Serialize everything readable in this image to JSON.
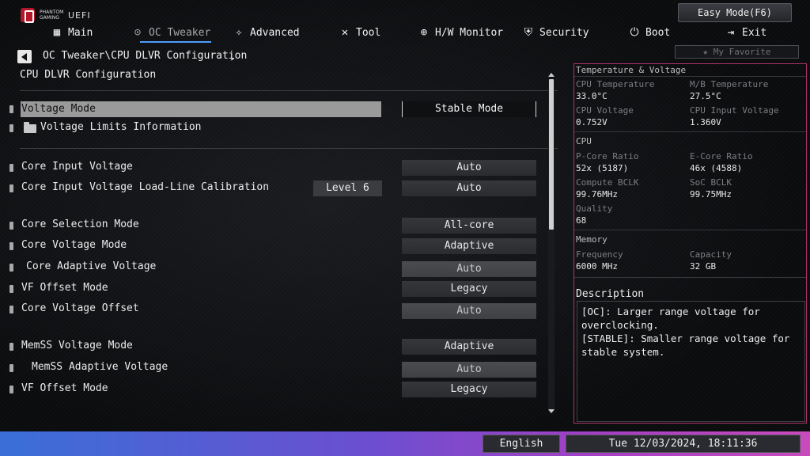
{
  "header": {
    "brand_small": "PHANTOM GAMING",
    "brand_uefi": "UEFI",
    "easy_mode_label": "Easy Mode(F6)",
    "favorite_label": "★ My Favorite"
  },
  "nav": [
    {
      "label": "Main",
      "icon": "grid-icon",
      "glyph": "▦"
    },
    {
      "label": "OC Tweaker",
      "icon": "circuit-icon",
      "glyph": "⊙"
    },
    {
      "label": "Advanced",
      "icon": "star-icon",
      "glyph": "✧"
    },
    {
      "label": "Tool",
      "icon": "tools-icon",
      "glyph": "✕"
    },
    {
      "label": "H/W Monitor",
      "icon": "monitor-icon",
      "glyph": "⊕"
    },
    {
      "label": "Security",
      "icon": "shield-icon",
      "glyph": "⛨"
    },
    {
      "label": "Boot",
      "icon": "power-icon",
      "glyph": "⏻"
    },
    {
      "label": "Exit",
      "icon": "exit-icon",
      "glyph": "⇥"
    }
  ],
  "breadcrumb": "OC Tweaker\\CPU DLVR Configuration",
  "page_title": "CPU DLVR Configuration",
  "settings": {
    "voltage_mode": {
      "label": "Voltage Mode",
      "value": "Stable Mode"
    },
    "voltage_limits": {
      "label": "Voltage Limits Information"
    },
    "core_input_voltage": {
      "label": "Core Input Voltage",
      "value": "Auto"
    },
    "core_input_llc": {
      "label": "Core Input Voltage Load-Line Calibration",
      "level": "Level 6",
      "value": "Auto"
    },
    "core_selection_mode": {
      "label": "Core Selection Mode",
      "value": "All-core"
    },
    "core_voltage_mode": {
      "label": "Core Voltage Mode",
      "value": "Adaptive"
    },
    "core_adaptive_voltage": {
      "label": "Core Adaptive Voltage",
      "value": "Auto"
    },
    "vf_offset_mode_1": {
      "label": "VF Offset Mode",
      "value": "Legacy"
    },
    "core_voltage_offset": {
      "label": "Core Voltage Offset",
      "value": "Auto"
    },
    "memss_voltage_mode": {
      "label": "MemSS Voltage Mode",
      "value": "Adaptive"
    },
    "memss_adaptive_voltage": {
      "label": "MemSS Adaptive Voltage",
      "value": "Auto"
    },
    "vf_offset_mode_2": {
      "label": "VF Offset Mode",
      "value": "Legacy"
    }
  },
  "info": {
    "temp_voltage_head": "Temperature & Voltage",
    "cpu_temp_label": "CPU Temperature",
    "cpu_temp": "33.0°C",
    "mb_temp_label": "M/B Temperature",
    "mb_temp": "27.5°C",
    "cpu_voltage_label": "CPU Voltage",
    "cpu_voltage": "0.752V",
    "cpu_input_voltage_label": "CPU Input Voltage",
    "cpu_input_voltage": "1.360V",
    "cpu_head": "CPU",
    "pcore_label": "P-Core Ratio",
    "pcore": "52x (5187)",
    "ecore_label": "E-Core Ratio",
    "ecore": "46x (4588)",
    "compute_bclk_label": "Compute BCLK",
    "compute_bclk": "99.76MHz",
    "soc_bclk_label": "SoC BCLK",
    "soc_bclk": "99.75MHz",
    "quality_label": "Quality",
    "quality": "68",
    "memory_head": "Memory",
    "frequency_label": "Frequency",
    "frequency": "6000 MHz",
    "capacity_label": "Capacity",
    "capacity": "32 GB"
  },
  "description": {
    "title": "Description",
    "text": "[OC]: Larger range voltage for overclocking.\n[STABLE]: Smaller range voltage for stable system."
  },
  "footer": {
    "language": "English",
    "datetime": "Tue 12/03/2024, 18:11:36"
  }
}
